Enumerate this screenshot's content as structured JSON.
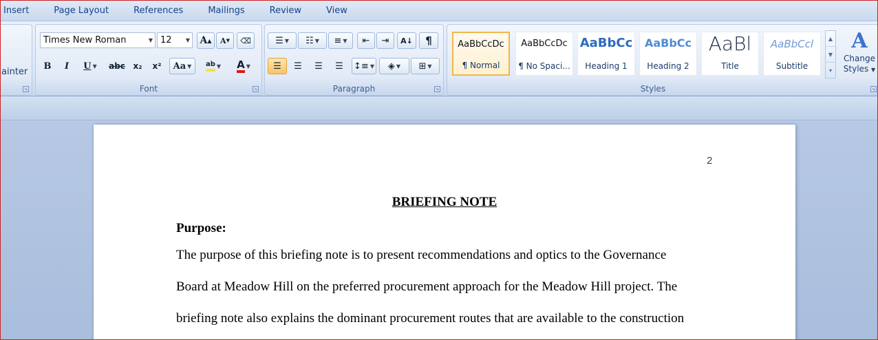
{
  "ribbon": {
    "tabs": [
      "Insert",
      "Page Layout",
      "References",
      "Mailings",
      "Review",
      "View"
    ],
    "clipboard": {
      "painter_label": "ainter"
    },
    "font": {
      "group_label": "Font",
      "family": "Times New Roman",
      "size": "12",
      "grow_label": "A",
      "shrink_label": "A",
      "bold": "B",
      "italic": "I",
      "underline": "U",
      "strike": "abc",
      "subscript": "x₂",
      "superscript": "x²",
      "change_case": "Aa",
      "highlight": "ab",
      "font_color": "A"
    },
    "paragraph": {
      "group_label": "Paragraph",
      "pilcrow": "¶",
      "sort": "A↓"
    },
    "styles": {
      "group_label": "Styles",
      "items": [
        {
          "sample": "AaBbCcDc",
          "name": "¶ Normal"
        },
        {
          "sample": "AaBbCcDc",
          "name": "¶ No Spaci..."
        },
        {
          "sample": "AaBbCc",
          "name": "Heading 1"
        },
        {
          "sample": "AaBbCc",
          "name": "Heading 2"
        },
        {
          "sample": "AaBl",
          "name": "Title"
        },
        {
          "sample": "AaBbCcl",
          "name": "Subtitle"
        }
      ],
      "change_styles_line1": "Change",
      "change_styles_line2": "Styles",
      "change_styles_icon": "A"
    },
    "colors": {
      "highlight": "#f7e33a",
      "font_color": "#e01515",
      "selected_border": "#f0b64a"
    }
  },
  "document": {
    "page_number": "2",
    "title": "BRIEFING NOTE",
    "heading": "Purpose:",
    "lines": [
      "The purpose of this briefing note is to present recommendations and optics to the Governance",
      "Board at Meadow Hill on the preferred procurement approach for the Meadow Hill project. The",
      "briefing note also explains the dominant procurement routes that are available to the construction"
    ]
  }
}
